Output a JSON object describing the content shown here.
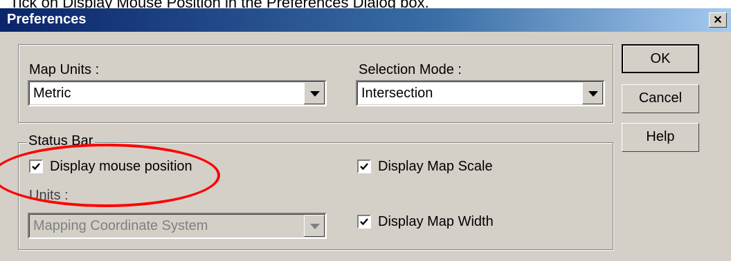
{
  "caption": "Tick on Display Mouse Position in the Preferences Dialog box.",
  "dialog": {
    "title": "Preferences",
    "close_glyph": "✕",
    "map_units": {
      "label": "Map Units :",
      "value": "Metric"
    },
    "selection_mode": {
      "label": "Selection Mode :",
      "value": "Intersection"
    },
    "status_bar": {
      "label": "Status Bar",
      "display_mouse_position": {
        "label": "Display mouse position",
        "checked": true
      },
      "display_map_scale": {
        "label": "Display Map Scale",
        "checked": true
      },
      "display_map_width": {
        "label": "Display Map Width",
        "checked": true
      },
      "units": {
        "label": "Units :",
        "value": "Mapping Coordinate System",
        "disabled": true
      }
    },
    "buttons": {
      "ok": "OK",
      "cancel": "Cancel",
      "help": "Help"
    }
  },
  "annotation": {
    "color": "#ff0000",
    "target": "display-mouse-position-checkbox"
  }
}
